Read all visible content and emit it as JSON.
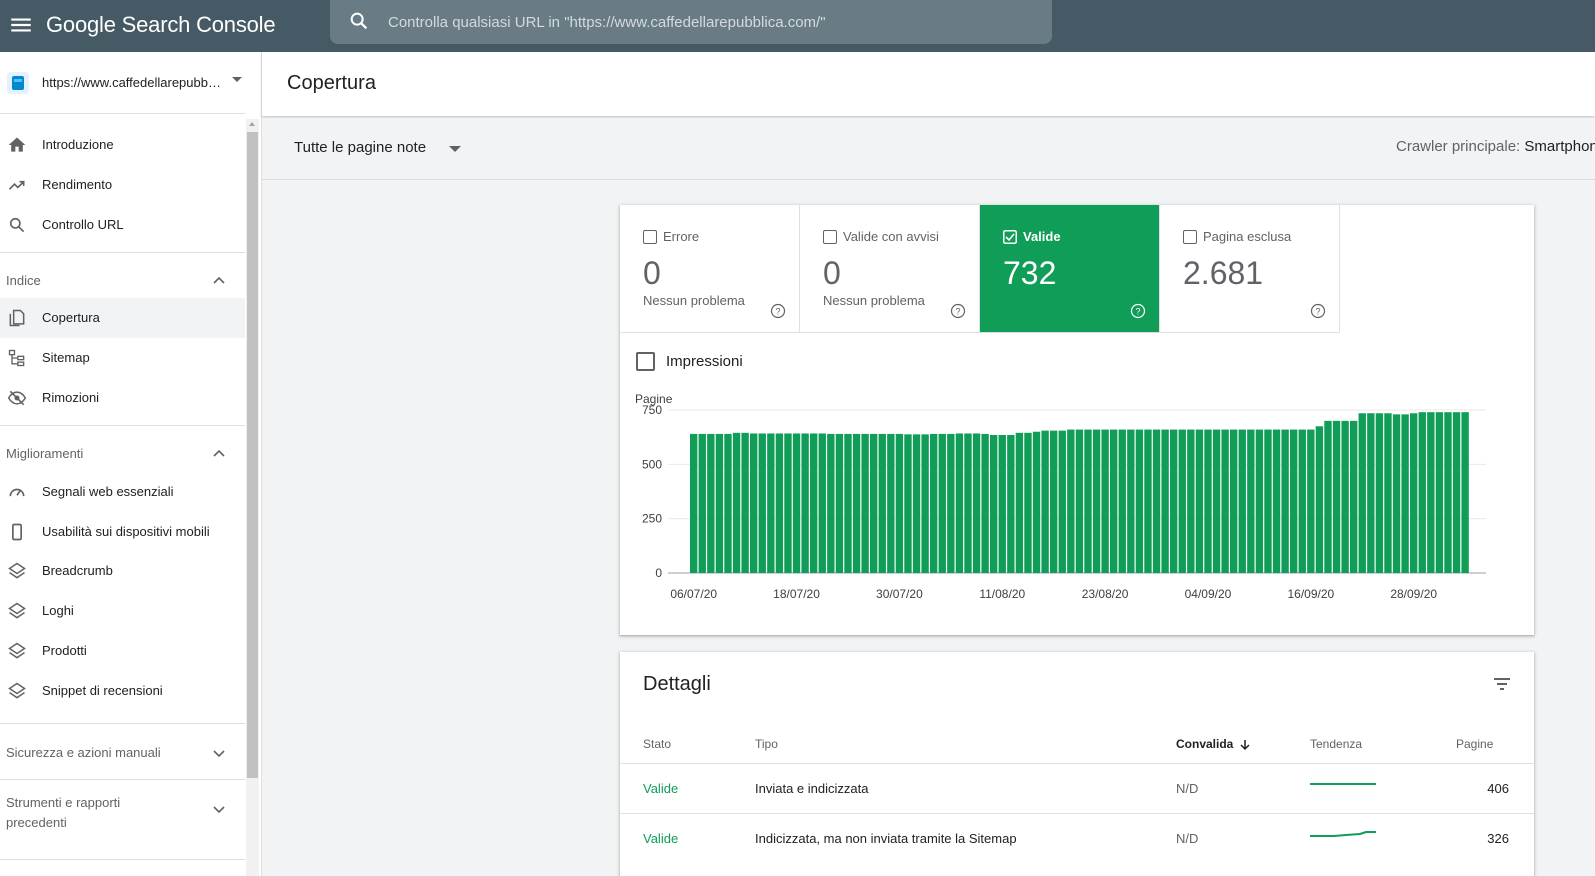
{
  "app": {
    "logo": "Google Search Console",
    "search_placeholder": "Controlla qualsiasi URL in \"https://www.caffedellarepubblica.com/\""
  },
  "sidebar": {
    "property_url": "https://www.caffedellarepubblica.com/",
    "items_top": [
      {
        "label": "Introduzione",
        "icon": "home-icon"
      },
      {
        "label": "Rendimento",
        "icon": "trending-up-icon"
      },
      {
        "label": "Controllo URL",
        "icon": "search-icon"
      }
    ],
    "section_indice": {
      "label": "Indice",
      "items": [
        {
          "label": "Copertura",
          "icon": "coverage-icon",
          "active": true
        },
        {
          "label": "Sitemap",
          "icon": "sitemap-icon"
        },
        {
          "label": "Rimozioni",
          "icon": "removals-icon"
        }
      ]
    },
    "section_miglioramenti": {
      "label": "Miglioramenti",
      "items": [
        {
          "label": "Segnali web essenziali",
          "icon": "speedometer-icon"
        },
        {
          "label": "Usabilità sui dispositivi mobili",
          "icon": "phone-icon"
        },
        {
          "label": "Breadcrumb",
          "icon": "layers-icon"
        },
        {
          "label": "Loghi",
          "icon": "layers-icon"
        },
        {
          "label": "Prodotti",
          "icon": "layers-icon"
        },
        {
          "label": "Snippet di recensioni",
          "icon": "layers-icon"
        }
      ]
    },
    "section_sicurezza": {
      "label": "Sicurezza e azioni manuali"
    },
    "section_strumenti": {
      "label_line1": "Strumenti e rapporti",
      "label_line2": "precedenti"
    }
  },
  "page": {
    "title": "Copertura",
    "filter_value": "Tutte le pagine note",
    "crawler_label": "Crawler principale:",
    "crawler_value": "Smartphone"
  },
  "summary": {
    "tiles": [
      {
        "label": "Errore",
        "count": "0",
        "sub": "Nessun problema",
        "selected": false
      },
      {
        "label": "Valide con avvisi",
        "count": "0",
        "sub": "Nessun problema",
        "selected": false
      },
      {
        "label": "Valide",
        "count": "732",
        "sub": "",
        "selected": true
      },
      {
        "label": "Pagina esclusa",
        "count": "2.681",
        "sub": "",
        "selected": false
      }
    ],
    "impressions_label": "Impressioni"
  },
  "chart_data": {
    "type": "bar",
    "ylabel": "Pagine",
    "ylim": [
      0,
      750
    ],
    "yticks": [
      0,
      250,
      500,
      750
    ],
    "xtick_labels": [
      "06/07/20",
      "18/07/20",
      "30/07/20",
      "11/08/20",
      "23/08/20",
      "04/09/20",
      "16/09/20",
      "28/09/20"
    ],
    "color": "#0f9d58",
    "grid": true,
    "values": [
      640,
      640,
      640,
      640,
      640,
      645,
      645,
      642,
      642,
      642,
      642,
      642,
      642,
      642,
      642,
      642,
      640,
      640,
      640,
      640,
      640,
      640,
      640,
      640,
      640,
      638,
      638,
      638,
      640,
      640,
      640,
      642,
      642,
      642,
      640,
      635,
      635,
      635,
      645,
      645,
      650,
      655,
      655,
      655,
      660,
      660,
      660,
      660,
      660,
      660,
      660,
      660,
      660,
      660,
      660,
      660,
      660,
      660,
      660,
      660,
      660,
      660,
      660,
      660,
      660,
      660,
      660,
      660,
      660,
      660,
      660,
      660,
      660,
      675,
      700,
      700,
      700,
      700,
      735,
      735,
      735,
      735,
      730,
      730,
      735,
      740,
      740,
      740,
      740,
      740,
      740
    ]
  },
  "details": {
    "title": "Dettagli",
    "headers": {
      "stato": "Stato",
      "tipo": "Tipo",
      "convalida": "Convalida",
      "tendenza": "Tendenza",
      "pagine": "Pagine"
    },
    "rows": [
      {
        "stato": "Valide",
        "tipo": "Inviata e indicizzata",
        "convalida": "N/D",
        "pagine": "406"
      },
      {
        "stato": "Valide",
        "tipo": "Indicizzata, ma non inviata tramite la Sitemap",
        "convalida": "N/D",
        "pagine": "326"
      }
    ]
  }
}
